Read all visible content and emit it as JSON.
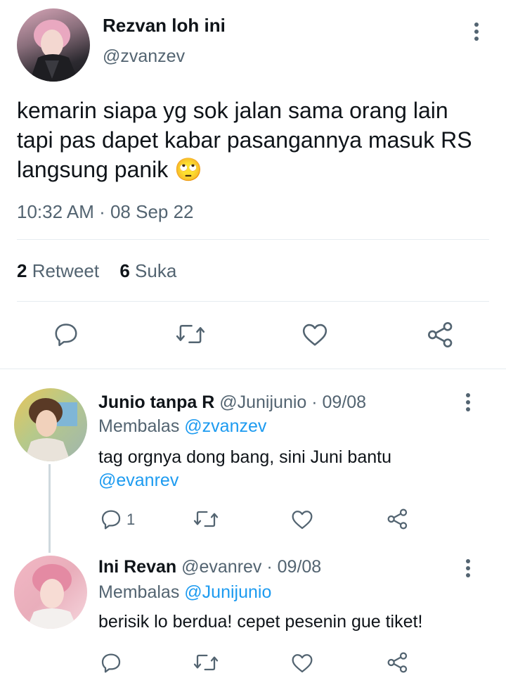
{
  "main_tweet": {
    "display_name": "Rezvan loh ini",
    "handle": "@zvanzev",
    "text": "kemarin siapa yg sok jalan sama orang lain tapi pas dapet kabar pasangannya masuk RS langsung panik",
    "emoji": "🙄",
    "timestamp": "10:32 AM · 08 Sep 22",
    "retweet_count": "2",
    "retweet_label": "Retweet",
    "like_count": "6",
    "like_label": "Suka"
  },
  "replies": [
    {
      "display_name": "Junio tanpa R",
      "handle_date": "@Junijunio · 09/08",
      "replying_label": "Membalas",
      "replying_to": "@zvanzev",
      "text": "tag orgnya dong bang, sini Juni bantu",
      "mention": "@evanrev",
      "reply_count": "1"
    },
    {
      "display_name": "Ini Revan",
      "handle_date": "@evanrev · 09/08",
      "replying_label": "Membalas",
      "replying_to": "@Junijunio",
      "text": "berisik lo berdua! cepet pesenin gue tiket!"
    }
  ],
  "icons": {
    "more": "more-vertical-icon",
    "reply": "reply-icon",
    "retweet": "retweet-icon",
    "like": "heart-icon",
    "share": "share-icon"
  },
  "colors": {
    "text": "#0f1419",
    "muted": "#536471",
    "link": "#1d9bf0",
    "divider": "#e6ecf0"
  }
}
